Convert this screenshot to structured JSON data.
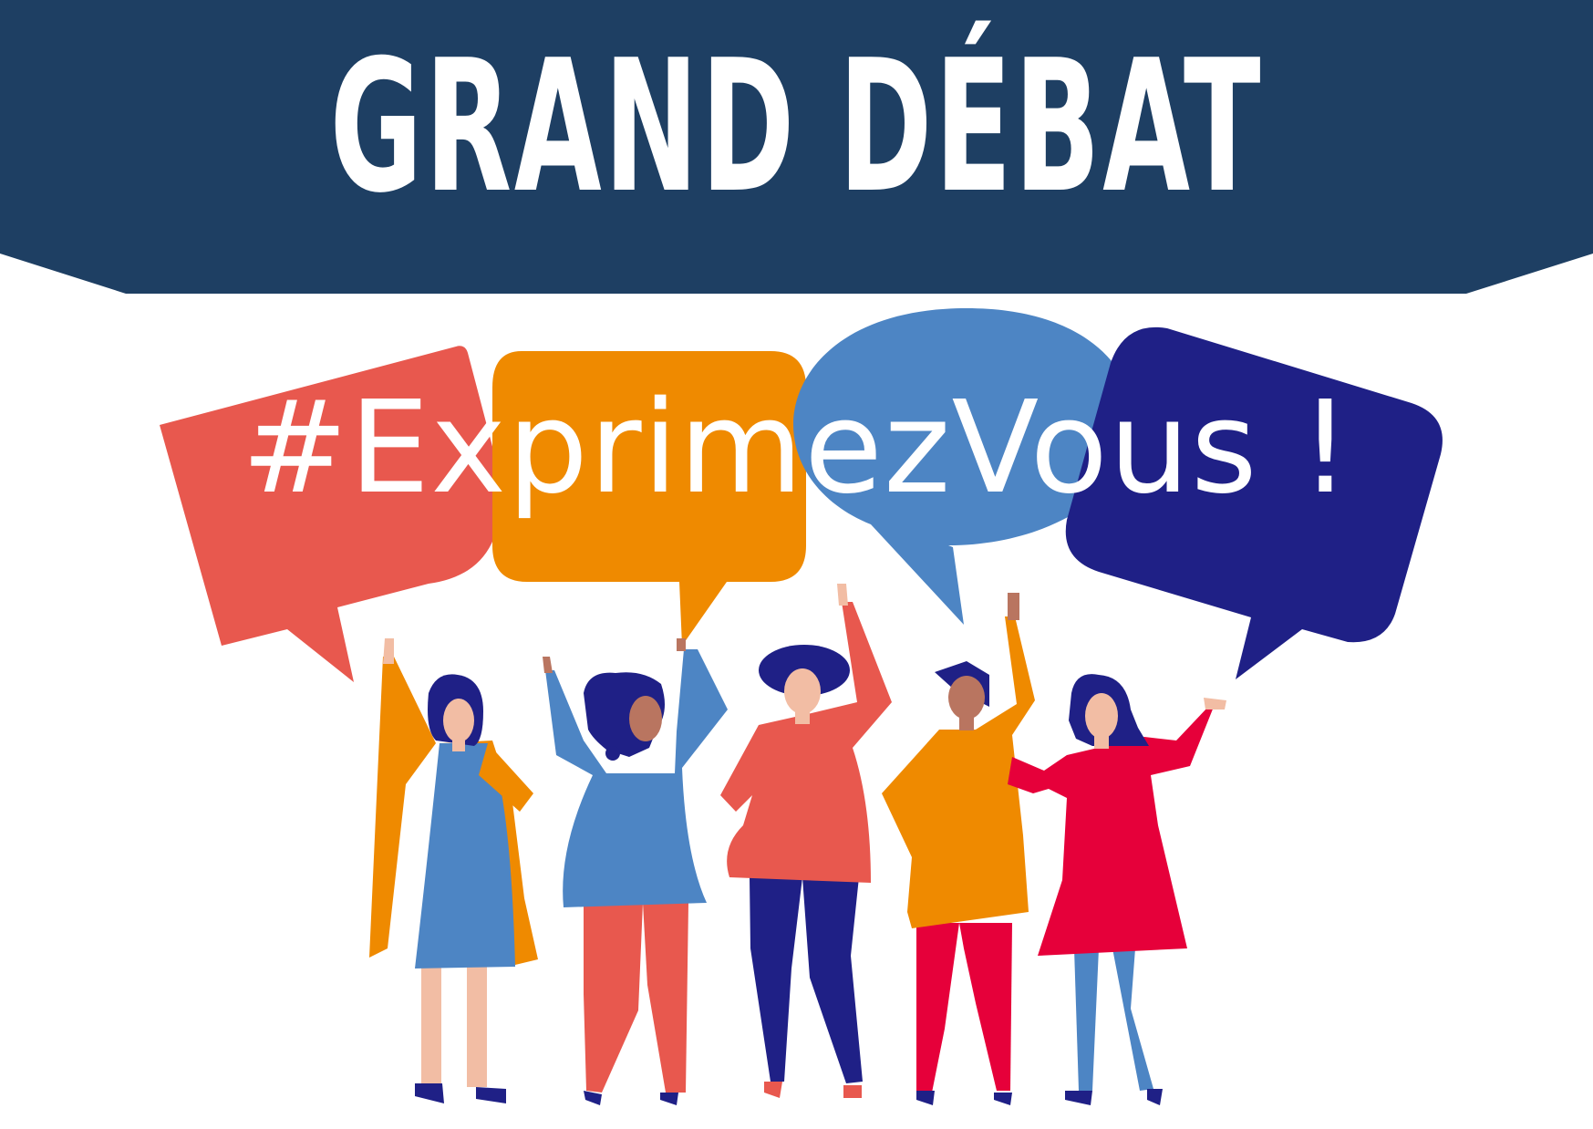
{
  "banner": {
    "title": "GRAND DÉBAT"
  },
  "hashtag": {
    "text": "#ExprimezVous !"
  },
  "colors": {
    "banner_bg": "#1e3f63",
    "bubble_red": "#e8584e",
    "bubble_orange": "#ef8a00",
    "bubble_light_blue": "#4d85c4",
    "bubble_navy": "#1f2086",
    "shirt_red": "#e6003a",
    "skin_light": "#f2bda4",
    "skin_dark": "#b97560",
    "hair": "#1f2086"
  },
  "icons": [
    "speech-bubble-red",
    "speech-bubble-orange",
    "speech-bubble-light-blue",
    "speech-bubble-navy"
  ]
}
